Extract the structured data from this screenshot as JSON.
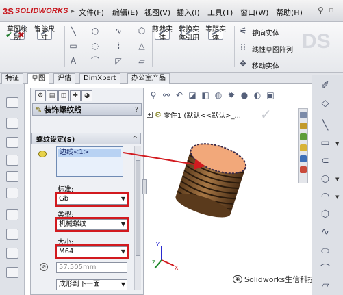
{
  "app": {
    "logo_prefix": "3S",
    "logo_text": "SOLIDWORKS"
  },
  "menu": {
    "items": [
      "文件(F)",
      "编辑(E)",
      "视图(V)",
      "插入(I)",
      "工具(T)",
      "窗口(W)",
      "帮助(H)"
    ]
  },
  "ribbon": {
    "sketch_draw": "草图绘制",
    "smart_dim": "智能尺寸",
    "trim": "剪裁实体",
    "convert": "转换实体引用",
    "offset": "等距实体",
    "mirror": "镜向实体",
    "linear_pattern": "线性草图阵列",
    "move": "移动实体"
  },
  "tabs": [
    "特征",
    "草图",
    "评估",
    "DimXpert",
    "办公室产品"
  ],
  "property_manager": {
    "title": "装饰螺纹线",
    "help": "?",
    "group_title": "螺纹设定(S)",
    "collapse": "^",
    "edge_item": "边线<1>",
    "standard_label": "标准:",
    "standard_value": "Gb",
    "type_label": "类型:",
    "type_value": "机械螺纹",
    "size_label": "大小:",
    "size_value": "M64",
    "diameter_value": "57.505mm",
    "end_condition": "成形到下一面"
  },
  "tree": {
    "expand": "+",
    "part_label": "零件1 (默认<<默认>_..."
  },
  "triad": {
    "x": "X",
    "y": "Y",
    "z": "Z"
  },
  "watermark": {
    "text": "Solidworks生信科技"
  },
  "colors": {
    "highlight_red": "#d21a1f",
    "cap_orange": "#f2a87a",
    "body_brown": "#8a6036"
  }
}
